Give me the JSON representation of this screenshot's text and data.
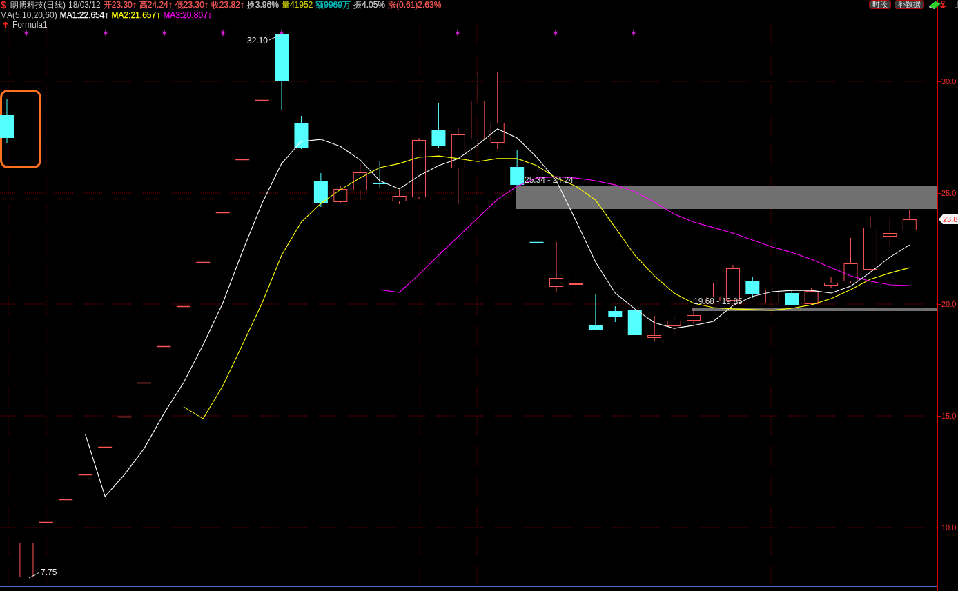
{
  "header": {
    "title": "朗博科技(日线)",
    "date": "18/03/12",
    "quotes": [
      {
        "text": "开23.30↑",
        "color": "#ff5c5c"
      },
      {
        "text": "高24.24↑",
        "color": "#ff5c5c"
      },
      {
        "text": "低23.30↑",
        "color": "#ff5c5c"
      },
      {
        "text": "收23.82↑",
        "color": "#ff5c5c"
      },
      {
        "text": "换3.96%",
        "color": "#c8c8c8"
      },
      {
        "text": "量41952",
        "color": "#c8c800"
      },
      {
        "text": "额9969万",
        "color": "#00c8c8"
      },
      {
        "text": "振4.05%",
        "color": "#c8c8c8"
      },
      {
        "text": "涨(0.61)2.63%",
        "color": "#ff5c5c"
      }
    ]
  },
  "indicator": {
    "label": "MA(5,10,20,60)",
    "readings": [
      ":22.654↑",
      ":21.657↑",
      ":20.807↓"
    ]
  },
  "formula": {
    "label": "Formula1"
  },
  "toolbar": {
    "buttons": [
      "时段",
      "补数据"
    ]
  },
  "chart": {
    "price_tag": "23.8",
    "high_label": "32.10",
    "low_label": "7.75",
    "zones": [
      {
        "label": "25.34 - 24.24"
      },
      {
        "label": "19.68 - 19.85"
      }
    ],
    "chart_data": {
      "type": "line",
      "grid": true,
      "ylim": [
        7.43,
        33.65
      ],
      "yticks": [
        {
          "value": 30,
          "label": "30.0"
        },
        {
          "value": 25,
          "label": "25.0"
        },
        {
          "value": 20,
          "label": "20.0"
        },
        {
          "value": 15,
          "label": "15.0"
        },
        {
          "value": 10,
          "label": "10.0"
        }
      ],
      "series": [
        {
          "name": "MA1",
          "color": "#ffffff",
          "values": [
            null,
            null,
            null,
            null,
            14.17,
            11.39,
            12.38,
            13.55,
            15.1,
            16.49,
            18.19,
            20.05,
            22.37,
            24.53,
            26.32,
            27.31,
            27.4,
            27.09,
            26.48,
            25.55,
            25.18,
            25.77,
            26.23,
            26.54,
            27.16,
            27.87,
            27.47,
            26.6,
            25.55,
            23.76,
            21.9,
            20.51,
            19.8,
            19.18,
            18.93,
            19.06,
            19.24,
            19.95,
            20.36,
            20.57,
            20.63,
            20.63,
            20.51,
            20.82,
            21.44,
            22.12,
            22.67
          ]
        },
        {
          "name": "MA2",
          "color": "#ffff00",
          "values": [
            null,
            null,
            null,
            null,
            null,
            null,
            null,
            null,
            null,
            15.41,
            14.88,
            16.34,
            18.19,
            20.05,
            22.21,
            23.69,
            24.53,
            25.15,
            25.67,
            26.14,
            26.32,
            26.6,
            26.66,
            26.54,
            26.41,
            26.54,
            26.54,
            26.23,
            25.67,
            25.3,
            24.68,
            23.45,
            22.21,
            21.28,
            20.51,
            20.05,
            19.86,
            19.8,
            19.77,
            19.74,
            19.83,
            19.98,
            20.26,
            20.66,
            21.13,
            21.41,
            21.65
          ]
        },
        {
          "name": "MA3",
          "color": "#ff00ff",
          "values": [
            null,
            null,
            null,
            null,
            null,
            null,
            null,
            null,
            null,
            null,
            null,
            null,
            null,
            null,
            null,
            null,
            null,
            null,
            null,
            20.66,
            20.54,
            21.34,
            22.21,
            23.04,
            23.88,
            24.71,
            25.3,
            25.67,
            25.73,
            25.67,
            25.55,
            25.36,
            25.05,
            24.59,
            24.06,
            23.69,
            23.45,
            23.2,
            22.89,
            22.58,
            22.33,
            22.02,
            21.65,
            21.28,
            21.04,
            20.88,
            20.85
          ]
        }
      ]
    }
  }
}
